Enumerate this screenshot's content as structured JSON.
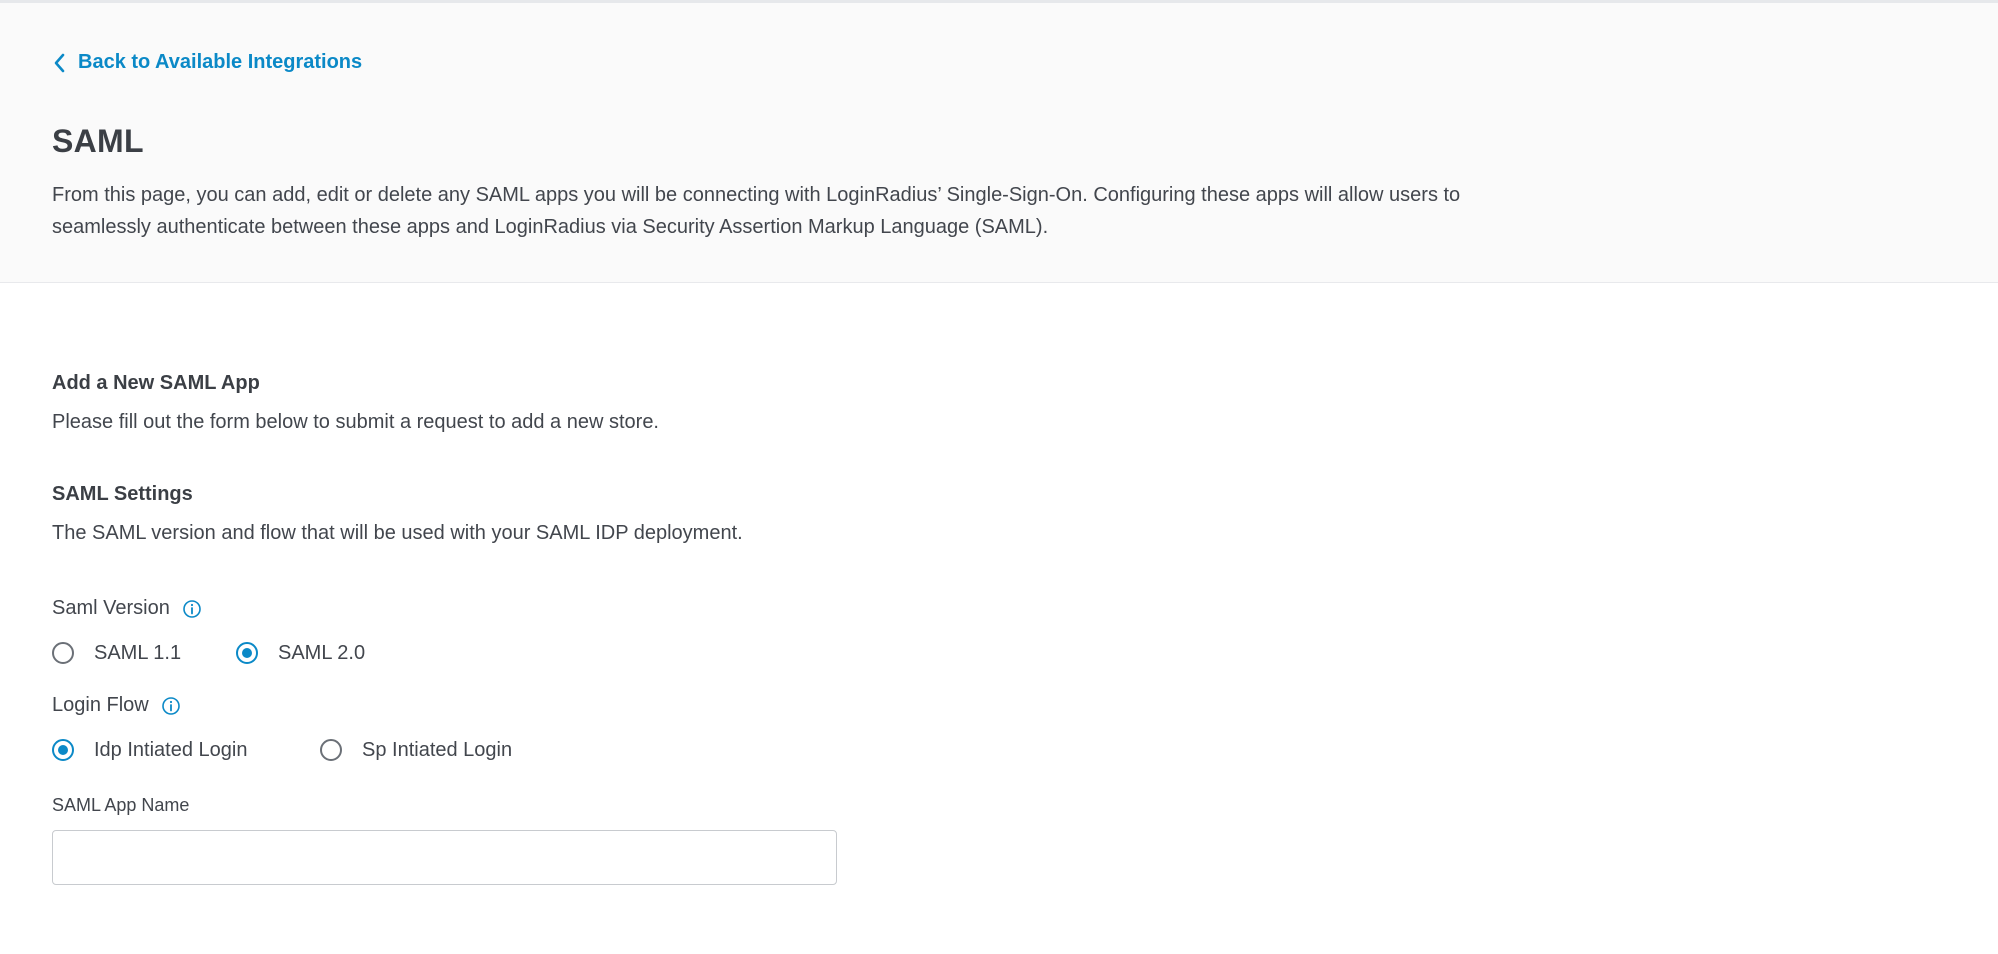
{
  "header": {
    "back_link": "Back to Available Integrations",
    "title": "SAML",
    "description": "From this page, you can add, edit or delete any SAML apps you will be connecting with LoginRadius’ Single-Sign-On. Configuring these apps will allow users to seamlessly authenticate between these apps and LoginRadius via Security Assertion Markup Language (SAML)."
  },
  "add_app": {
    "title": "Add a New SAML App",
    "description": "Please fill out the form below to submit a request to add a new store."
  },
  "saml_settings": {
    "title": "SAML Settings",
    "description": "The SAML version and flow that will be used with your SAML IDP deployment."
  },
  "saml_version": {
    "label": "Saml Version",
    "options": [
      "SAML 1.1",
      "SAML 2.0"
    ],
    "selected": "SAML 2.0"
  },
  "login_flow": {
    "label": "Login Flow",
    "options": [
      "Idp Intiated Login",
      "Sp Intiated Login"
    ],
    "selected": "Idp Intiated Login"
  },
  "app_name": {
    "label": "SAML App Name",
    "value": ""
  },
  "colors": {
    "accent": "#0b89c7",
    "text": "#42464d",
    "header_bg": "#fafafa"
  },
  "icons": {
    "back": "chevron-left-icon",
    "info": "info-icon"
  }
}
